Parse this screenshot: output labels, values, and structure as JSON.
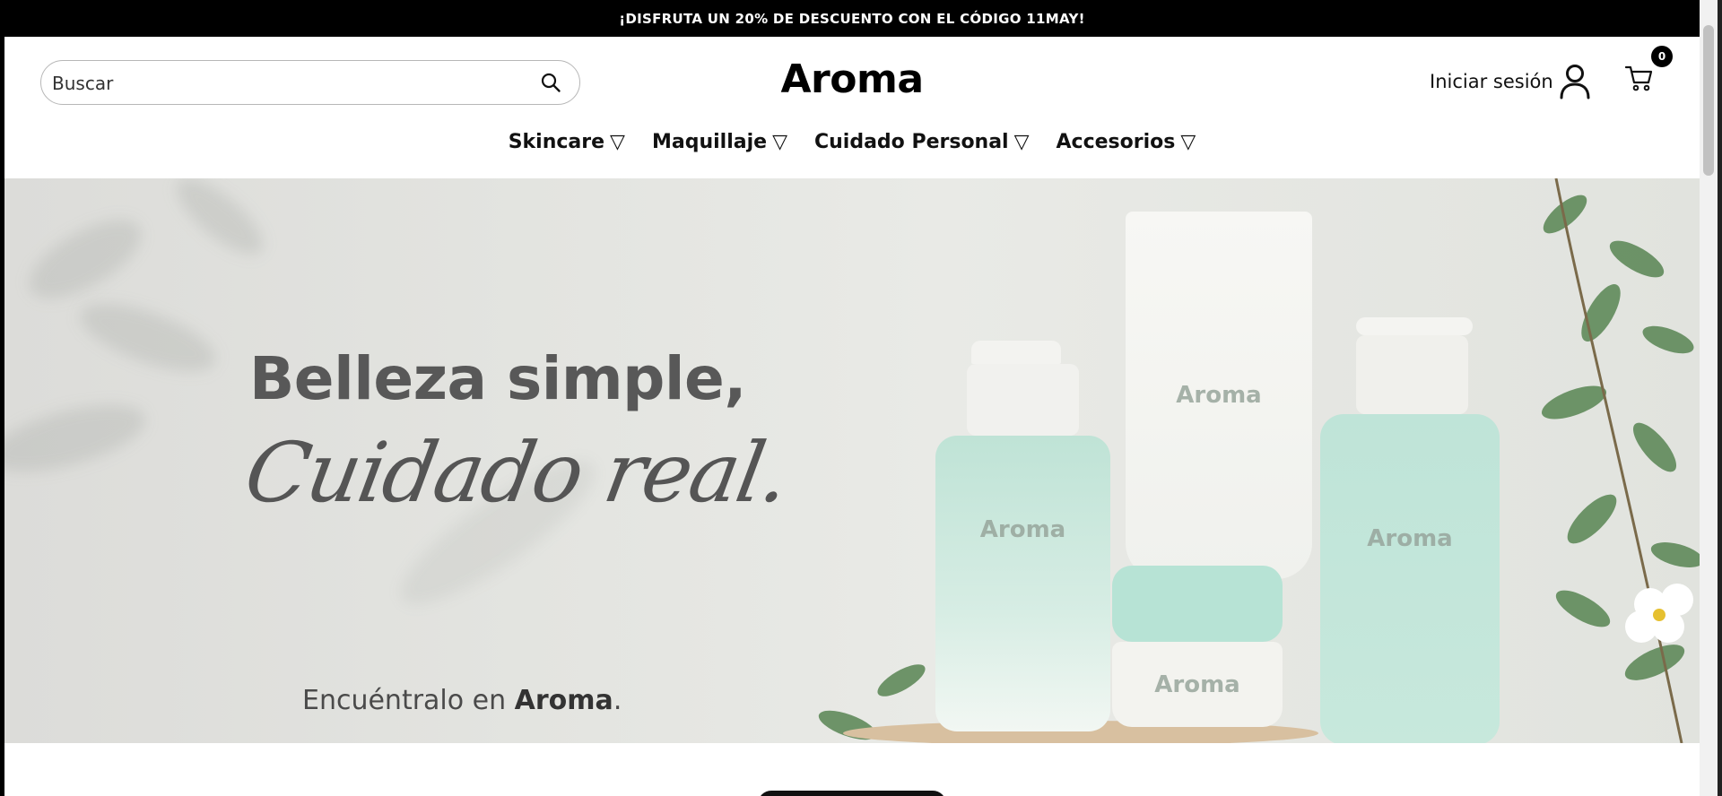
{
  "announcement": {
    "text": "¡DISFRUTA UN 20% DE DESCUENTO CON EL CÓDIGO 11MAY!"
  },
  "search": {
    "placeholder": "Buscar",
    "value": ""
  },
  "brand": {
    "logo": "Aroma"
  },
  "account": {
    "login_label": "Iniciar sesión",
    "icon": "user-icon"
  },
  "cart": {
    "icon": "cart-icon",
    "count": "0"
  },
  "nav": {
    "items": [
      {
        "label": "Skincare",
        "arrow": "▽"
      },
      {
        "label": "Maquillaje",
        "arrow": "▽"
      },
      {
        "label": "Cuidado Personal",
        "arrow": "▽"
      },
      {
        "label": "Accesorios",
        "arrow": "▽"
      }
    ]
  },
  "hero": {
    "headline": "Belleza simple,",
    "script": "Cuidado real.",
    "sub_prefix": "Encuéntralo en ",
    "sub_brand": "Aroma",
    "sub_suffix": ".",
    "product_labels": [
      "Aroma",
      "Aroma",
      "Aroma",
      "Aroma"
    ]
  },
  "colors": {
    "announcement_bg": "#000000",
    "mint": "#bfe3d6",
    "text": "#111111"
  }
}
